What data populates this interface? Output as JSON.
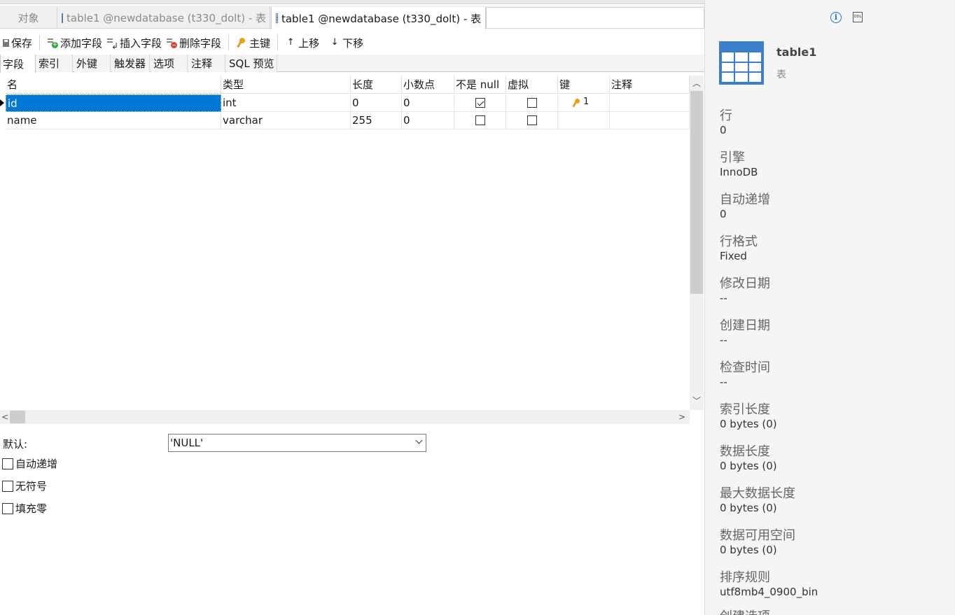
{
  "tabs": [
    {
      "label": "对象",
      "active": false
    },
    {
      "label": "table1 @newdatabase (t330_dolt) - 表",
      "active": false
    },
    {
      "label": "table1 @newdatabase (t330_dolt) - 表",
      "active": true
    }
  ],
  "toolbar": {
    "save": "保存",
    "add_field": "添加字段",
    "insert_field": "插入字段",
    "delete_field": "删除字段",
    "primary_key": "主键",
    "move_up": "上移",
    "move_down": "下移"
  },
  "subtabs": [
    "字段",
    "索引",
    "外键",
    "触发器",
    "选项",
    "注释",
    "SQL 预览"
  ],
  "grid": {
    "headers": [
      "名",
      "类型",
      "长度",
      "小数点",
      "不是 null",
      "虚拟",
      "键",
      "注释"
    ],
    "rows": [
      {
        "name": "id",
        "type": "int",
        "length": "0",
        "decimals": "0",
        "not_null": true,
        "virtual": false,
        "key": "1",
        "comment": ""
      },
      {
        "name": "name",
        "type": "varchar",
        "length": "255",
        "decimals": "0",
        "not_null": false,
        "virtual": false,
        "key": "",
        "comment": ""
      }
    ]
  },
  "field_props": {
    "default_label": "默认:",
    "default_value": "'NULL'",
    "auto_increment": "自动递增",
    "unsigned": "无符号",
    "zerofill": "填充零"
  },
  "info": {
    "table_name": "table1",
    "object_type": "表",
    "items": [
      {
        "label": "行",
        "value": "0"
      },
      {
        "label": "引擎",
        "value": "InnoDB"
      },
      {
        "label": "自动递增",
        "value": "0"
      },
      {
        "label": "行格式",
        "value": "Fixed"
      },
      {
        "label": "修改日期",
        "value": "--"
      },
      {
        "label": "创建日期",
        "value": "--"
      },
      {
        "label": "检查时间",
        "value": "--"
      },
      {
        "label": "索引长度",
        "value": "0 bytes (0)"
      },
      {
        "label": "数据长度",
        "value": "0 bytes (0)"
      },
      {
        "label": "最大数据长度",
        "value": "0 bytes (0)"
      },
      {
        "label": "数据可用空间",
        "value": "0 bytes (0)"
      },
      {
        "label": "排序规则",
        "value": "utf8mb4_0900_bin"
      },
      {
        "label": "创建选项",
        "value": ""
      }
    ]
  },
  "icons": {
    "info": "i",
    "ddl": "DDL",
    "up": "↑",
    "down": "↓",
    "key": "🔑",
    "scroll_up": "︿",
    "scroll_down": "﹀",
    "scroll_left": "<",
    "scroll_right": ">"
  },
  "colors": {
    "selection": "#0078d7",
    "accent": "#3b7ec9"
  }
}
